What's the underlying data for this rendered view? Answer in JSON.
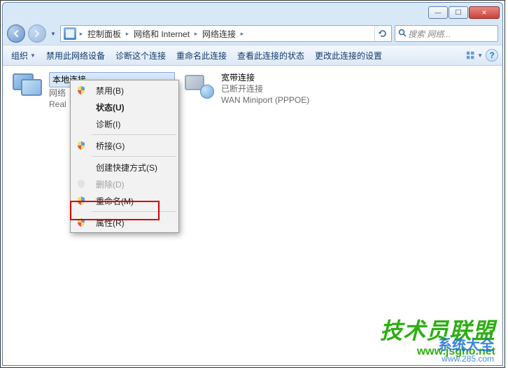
{
  "window": {
    "min_tip": "—",
    "max_tip": "☐",
    "close_tip": "✕"
  },
  "address": {
    "crumbs": [
      "控制面板",
      "网络和 Internet",
      "网络连接"
    ]
  },
  "search": {
    "placeholder": "搜索 网络..."
  },
  "toolbar": {
    "org": "组织",
    "disable": "禁用此网络设备",
    "diagnose": "诊断这个连接",
    "rename": "重命名此连接",
    "status": "查看此连接的状态",
    "change": "更改此连接的设置"
  },
  "connections": {
    "local": {
      "title": "本地连接",
      "sub1": "网络",
      "sub2_prefix": "Real"
    },
    "broadband": {
      "title": "宽带连接",
      "sub1": "已断开连接",
      "sub2": "WAN Miniport (PPPOE)"
    }
  },
  "context_menu": {
    "disable": "禁用(B)",
    "status": "状态(U)",
    "diagnose": "诊断(I)",
    "bridge": "桥接(G)",
    "shortcut": "创建快捷方式(S)",
    "delete": "删除(D)",
    "rename": "重命名(M)",
    "properties": "属性(R)"
  },
  "watermark": {
    "green_text": "技术员联盟",
    "green_url": "www.jsgho.net",
    "blue_text": "系统大全",
    "blue_url": "www.285.com"
  }
}
